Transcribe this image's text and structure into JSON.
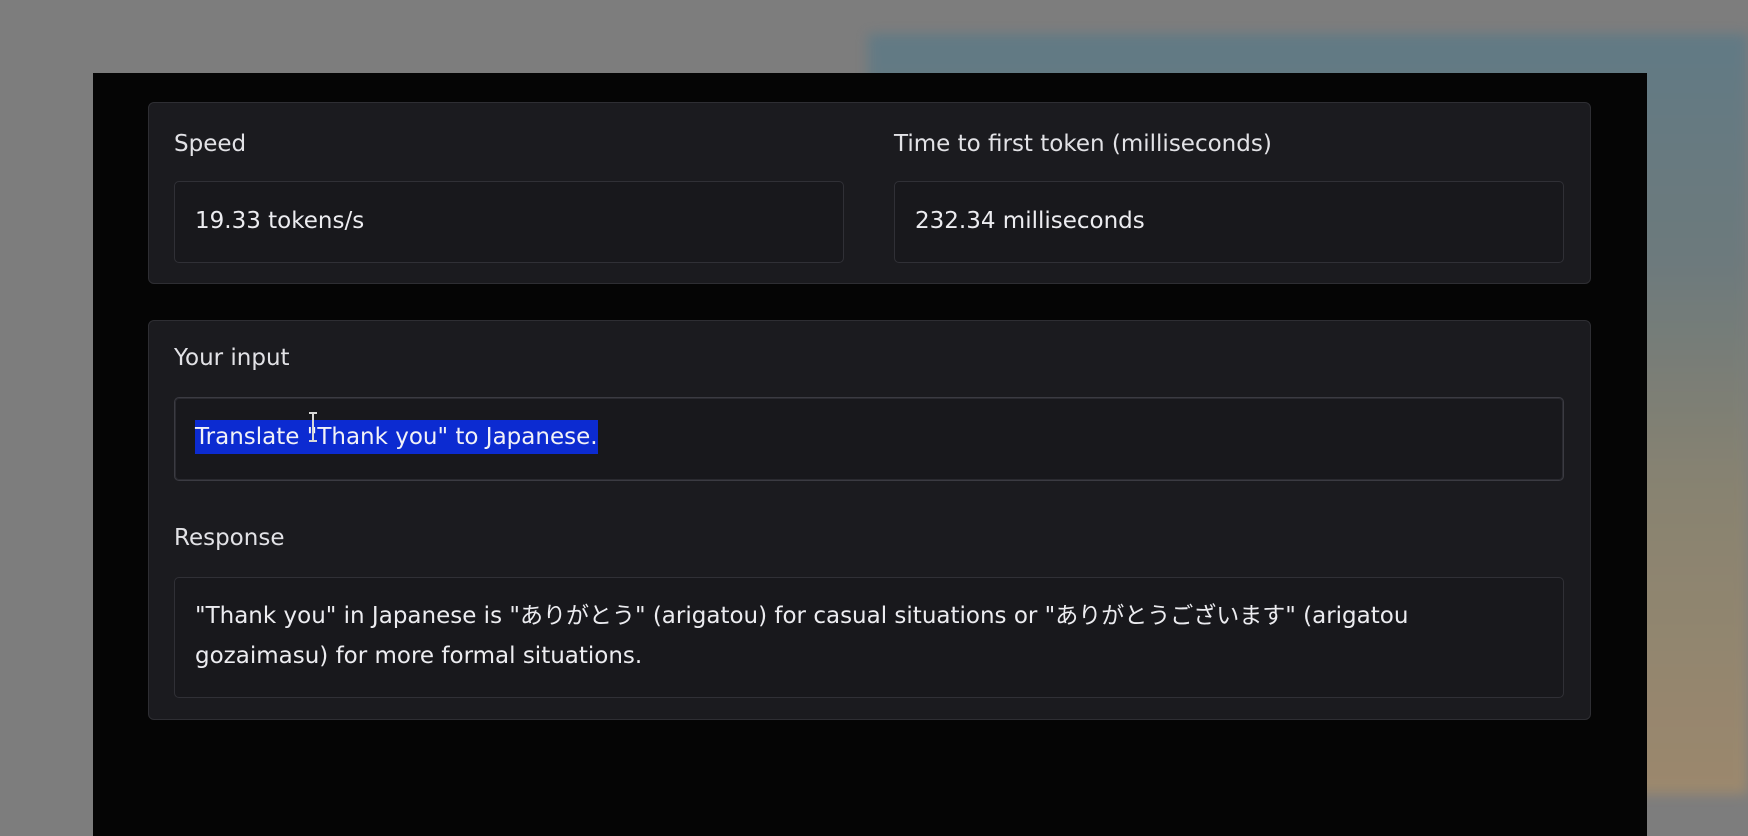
{
  "metrics": {
    "speed": {
      "label": "Speed",
      "value": "19.33 tokens/s"
    },
    "ttft": {
      "label": "Time to first token (milliseconds)",
      "value": "232.34 milliseconds"
    }
  },
  "chat": {
    "input_label": "Your input",
    "input_value": "Translate \"Thank you\" to Japanese.",
    "response_label": "Response",
    "response_value": "\"Thank you\" in Japanese is \"ありがとう\" (arigatou) for casual situations or \"ありがとうございます\" (arigatou gozaimasu) for more formal situations."
  },
  "icons": {
    "cursor": "text-cursor-icon"
  },
  "colors": {
    "selection": "#0c2bd1",
    "panel": "#1b1b1f",
    "window": "#050505"
  }
}
